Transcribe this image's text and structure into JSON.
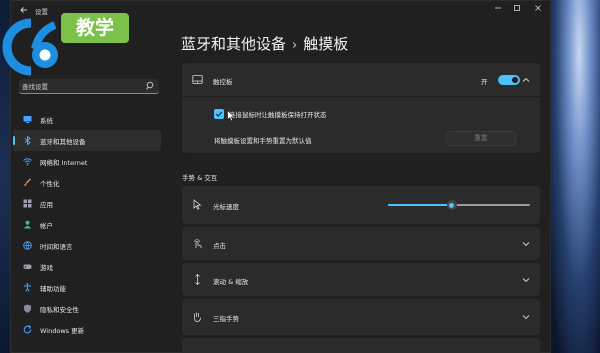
{
  "window": {
    "title": "设置"
  },
  "logo": {
    "badge_text": "教学"
  },
  "search": {
    "placeholder": "查找设置"
  },
  "sidebar": {
    "items": [
      {
        "label": "系统",
        "icon": "monitor-icon"
      },
      {
        "label": "蓝牙和其他设备",
        "icon": "bluetooth-icon",
        "selected": true
      },
      {
        "label": "网络和 Internet",
        "icon": "wifi-icon"
      },
      {
        "label": "个性化",
        "icon": "brush-icon"
      },
      {
        "label": "应用",
        "icon": "apps-icon"
      },
      {
        "label": "帐户",
        "icon": "person-icon"
      },
      {
        "label": "时间和语言",
        "icon": "globe-icon"
      },
      {
        "label": "游戏",
        "icon": "gamepad-icon"
      },
      {
        "label": "辅助功能",
        "icon": "accessibility-icon"
      },
      {
        "label": "隐私和安全性",
        "icon": "shield-icon"
      },
      {
        "label": "Windows 更新",
        "icon": "update-icon"
      }
    ]
  },
  "breadcrumb": {
    "parent": "蓝牙和其他设备",
    "separator": "›",
    "current": "触摸板"
  },
  "touchpad": {
    "label": "触控板",
    "toggle_label": "开",
    "toggle_on": true,
    "checkbox_label": "连接鼠标时让触摸板保持打开状态",
    "checkbox_checked": true,
    "reset_label": "将触摸板设置和手势重置为默认值",
    "reset_button": "重置"
  },
  "gestures": {
    "section_title": "手势 & 交互",
    "cursor_speed_label": "光标速度",
    "cursor_speed_fraction": 0.45,
    "rows": [
      {
        "label": "点击",
        "icon": "tap-icon"
      },
      {
        "label": "滚动 & 缩放",
        "icon": "scroll-zoom-icon"
      },
      {
        "label": "三指手势",
        "icon": "three-finger-icon"
      }
    ]
  },
  "colors": {
    "accent": "#4cc2ff",
    "logo_green": "#7cc24a",
    "logo_blue": "#1e8fe0"
  }
}
